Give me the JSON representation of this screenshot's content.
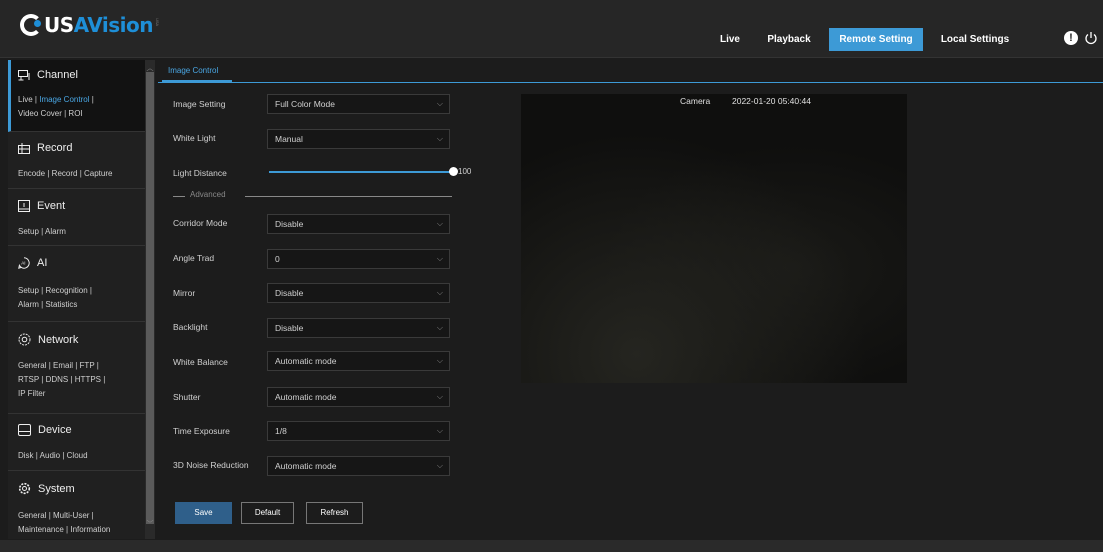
{
  "logo": {
    "us": "US",
    "rest": "AVision",
    "sub": "USA"
  },
  "topnav": {
    "live": "Live",
    "playback": "Playback",
    "remote_setting": "Remote Setting",
    "local_settings": "Local Settings"
  },
  "sidebar": {
    "channel": {
      "title": "Channel",
      "links": [
        "Live",
        "Image Control",
        "Video Cover",
        "ROI"
      ]
    },
    "record": {
      "title": "Record",
      "links": [
        "Encode",
        "Record",
        "Capture"
      ]
    },
    "event": {
      "title": "Event",
      "links": [
        "Setup",
        "Alarm"
      ]
    },
    "ai": {
      "title": "AI",
      "links": [
        "Setup",
        "Recognition",
        "Alarm",
        "Statistics"
      ]
    },
    "network": {
      "title": "Network",
      "links": [
        "General",
        "Email",
        "FTP",
        "RTSP",
        "DDNS",
        "HTTPS",
        "IP Filter"
      ]
    },
    "device": {
      "title": "Device",
      "links": [
        "Disk",
        "Audio",
        "Cloud"
      ]
    },
    "system": {
      "title": "System",
      "links": [
        "General",
        "Multi-User",
        "Maintenance",
        "Information"
      ]
    }
  },
  "tab": "Image Control",
  "form": {
    "image_setting": {
      "label": "Image Setting",
      "value": "Full Color Mode"
    },
    "white_light": {
      "label": "White Light",
      "value": "Manual"
    },
    "light_distance": {
      "label": "Light Distance",
      "value": "100",
      "level": 100
    },
    "advanced": "Advanced",
    "corridor_mode": {
      "label": "Corridor Mode",
      "value": "Disable"
    },
    "angle_trad": {
      "label": "Angle Trad",
      "value": "0"
    },
    "mirror": {
      "label": "Mirror",
      "value": "Disable"
    },
    "backlight": {
      "label": "Backlight",
      "value": "Disable"
    },
    "white_balance": {
      "label": "White Balance",
      "value": "Automatic mode"
    },
    "shutter": {
      "label": "Shutter",
      "value": "Automatic mode"
    },
    "time_exposure": {
      "label": "Time Exposure",
      "value": "1/8"
    },
    "noise_reduction": {
      "label": "3D Noise Reduction",
      "value": "Automatic mode"
    }
  },
  "buttons": {
    "save": "Save",
    "default": "Default",
    "refresh": "Refresh"
  },
  "preview": {
    "camera": "Camera",
    "timestamp": "2022-01-20 05:40:44"
  },
  "colors": {
    "accent": "#3d9ad6",
    "brand": "#1e8fd8"
  }
}
